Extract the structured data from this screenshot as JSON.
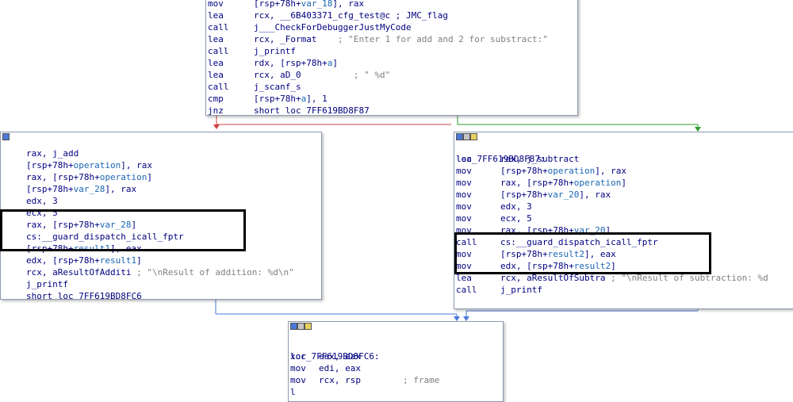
{
  "top_block": {
    "lines": [
      {
        "m": "mov",
        "o": [
          {
            "t": "[rsp+78h+"
          },
          {
            "t": "var_18",
            "h": true
          },
          {
            "t": "], rax"
          }
        ]
      },
      {
        "m": "lea",
        "o": [
          {
            "t": "rcx, __6B403371_cfg_test@c ; JMC_flag"
          }
        ]
      },
      {
        "m": "call",
        "o": [
          {
            "t": "j___CheckForDebuggerJustMyCode"
          }
        ]
      },
      {
        "m": "lea",
        "o": [
          {
            "t": "rcx, _Format    "
          },
          {
            "t": "; \"Enter 1 for add and 2 for substract:\"",
            "c": true
          }
        ]
      },
      {
        "m": "call",
        "o": [
          {
            "t": "j_printf"
          }
        ]
      },
      {
        "m": "lea",
        "o": [
          {
            "t": "rdx, [rsp+78h+"
          },
          {
            "t": "a",
            "h": true
          },
          {
            "t": "]"
          }
        ]
      },
      {
        "m": "lea",
        "o": [
          {
            "t": "rcx, aD_0          "
          },
          {
            "t": "; \" %d\"",
            "c": true
          }
        ]
      },
      {
        "m": "call",
        "o": [
          {
            "t": "j_scanf_s"
          }
        ]
      },
      {
        "m": "cmp",
        "o": [
          {
            "t": "[rsp+78h+"
          },
          {
            "t": "a",
            "h": true
          },
          {
            "t": "], 1"
          }
        ]
      },
      {
        "m": "jnz",
        "o": [
          {
            "t": "short loc_7FF619BD8F87"
          }
        ]
      }
    ]
  },
  "left_block": {
    "lines": [
      {
        "m": "",
        "o": [
          {
            "t": "rax, j_add"
          }
        ]
      },
      {
        "m": "",
        "o": [
          {
            "t": "[rsp+78h+"
          },
          {
            "t": "operation",
            "h": true
          },
          {
            "t": "], rax"
          }
        ]
      },
      {
        "m": "",
        "o": [
          {
            "t": "rax, [rsp+78h+"
          },
          {
            "t": "operation",
            "h": true
          },
          {
            "t": "]"
          }
        ]
      },
      {
        "m": "",
        "o": [
          {
            "t": "[rsp+78h+"
          },
          {
            "t": "var_28",
            "h": true
          },
          {
            "t": "], rax"
          }
        ]
      },
      {
        "m": "",
        "o": [
          {
            "t": "edx, 3"
          }
        ]
      },
      {
        "m": "",
        "o": [
          {
            "t": "ecx, 5"
          }
        ]
      },
      {
        "m": "",
        "o": [
          {
            "t": "rax, [rsp+78h+"
          },
          {
            "t": "var_28",
            "h": true
          },
          {
            "t": "]"
          }
        ]
      },
      {
        "m": "",
        "o": [
          {
            "t": "cs:__guard_dispatch_icall_fptr"
          }
        ]
      },
      {
        "m": "",
        "o": [
          {
            "t": "[rsp+78h+"
          },
          {
            "t": "result1",
            "h": true
          },
          {
            "t": "], eax"
          }
        ]
      },
      {
        "m": "",
        "o": [
          {
            "t": "edx, [rsp+78h+"
          },
          {
            "t": "result1",
            "h": true
          },
          {
            "t": "]"
          }
        ]
      },
      {
        "m": "",
        "o": [
          {
            "t": "rcx, aResultOfAdditi "
          },
          {
            "t": "; \"\\nResult of addition: %d\\n\"",
            "c": true
          }
        ]
      },
      {
        "m": "",
        "o": [
          {
            "t": "j_printf"
          }
        ]
      },
      {
        "m": "",
        "o": [
          {
            "t": "short loc_7FF619BD8FC6"
          }
        ]
      }
    ]
  },
  "right_block": {
    "label": "loc_7FF619BD8F87:",
    "lines": [
      {
        "m": "lea",
        "o": [
          {
            "t": "rax, j_subtract"
          }
        ]
      },
      {
        "m": "mov",
        "o": [
          {
            "t": "[rsp+78h+"
          },
          {
            "t": "operation",
            "h": true
          },
          {
            "t": "], rax"
          }
        ]
      },
      {
        "m": "mov",
        "o": [
          {
            "t": "rax, [rsp+78h+"
          },
          {
            "t": "operation",
            "h": true
          },
          {
            "t": "]"
          }
        ]
      },
      {
        "m": "mov",
        "o": [
          {
            "t": "[rsp+78h+"
          },
          {
            "t": "var_20",
            "h": true
          },
          {
            "t": "], rax"
          }
        ]
      },
      {
        "m": "mov",
        "o": [
          {
            "t": "edx, 3"
          }
        ]
      },
      {
        "m": "mov",
        "o": [
          {
            "t": "ecx, 5"
          }
        ]
      },
      {
        "m": "mov",
        "o": [
          {
            "t": "rax, [rsp+78h+"
          },
          {
            "t": "var_20",
            "h": true
          },
          {
            "t": "]"
          }
        ]
      },
      {
        "m": "call",
        "o": [
          {
            "t": "cs:__guard_dispatch_icall_fptr"
          }
        ]
      },
      {
        "m": "mov",
        "o": [
          {
            "t": "[rsp+78h+"
          },
          {
            "t": "result2",
            "h": true
          },
          {
            "t": "], eax"
          }
        ]
      },
      {
        "m": "mov",
        "o": [
          {
            "t": "edx, [rsp+78h+"
          },
          {
            "t": "result2",
            "h": true
          },
          {
            "t": "]"
          }
        ]
      },
      {
        "m": "lea",
        "o": [
          {
            "t": "rcx, aResultOfSubtra "
          },
          {
            "t": "; \"\\nResult of subtraction: %d",
            "c": true
          }
        ]
      },
      {
        "m": "call",
        "o": [
          {
            "t": "j_printf"
          }
        ]
      }
    ]
  },
  "bottom_block": {
    "label": "loc_7FF619BD8FC6:",
    "lines": [
      {
        "m": "xor",
        "o": [
          {
            "t": "eax, eax"
          }
        ]
      },
      {
        "m": "mov",
        "o": [
          {
            "t": "edi, eax"
          }
        ]
      },
      {
        "m": "mov",
        "o": [
          {
            "t": "rcx, rsp        "
          },
          {
            "t": "; frame",
            "c": true
          }
        ]
      },
      {
        "m": "l",
        "o": [
          {
            "t": "       "
          }
        ]
      }
    ]
  },
  "colors": {
    "edge_false": "#d04040",
    "edge_true": "#2e9e2e",
    "edge_jump": "#4a78d8",
    "highlight_text": "#1a66b5",
    "comment_text": "#808080"
  }
}
